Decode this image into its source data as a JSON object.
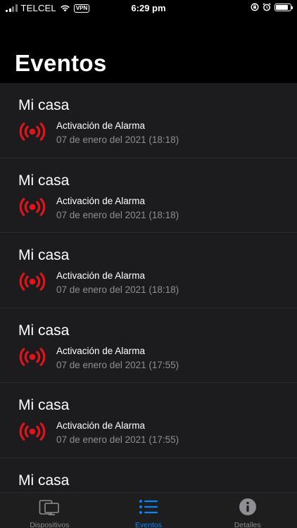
{
  "status_bar": {
    "carrier": "TELCEL",
    "vpn": "VPN",
    "time": "6:29 pm",
    "battery_level": 0.85
  },
  "page": {
    "title": "Eventos"
  },
  "events": [
    {
      "title": "Mi casa",
      "label": "Activación de Alarma",
      "date": "07 de enero del 2021 (18:18)"
    },
    {
      "title": "Mi casa",
      "label": "Activación de Alarma",
      "date": "07 de enero del 2021 (18:18)"
    },
    {
      "title": "Mi casa",
      "label": "Activación de Alarma",
      "date": "07 de enero del 2021 (18:18)"
    },
    {
      "title": "Mi casa",
      "label": "Activación de Alarma",
      "date": "07 de enero del 2021 (17:55)"
    },
    {
      "title": "Mi casa",
      "label": "Activación de Alarma",
      "date": "07 de enero del 2021 (17:55)"
    },
    {
      "title": "Mi casa",
      "label": "",
      "date": ""
    }
  ],
  "tab_bar": {
    "tabs": [
      {
        "label": "Dispositivos",
        "icon": "devices-icon",
        "active": false
      },
      {
        "label": "Eventos",
        "icon": "list-icon",
        "active": true
      },
      {
        "label": "Detalles",
        "icon": "info-icon",
        "active": false
      }
    ]
  },
  "colors": {
    "accent": "#0a84ff",
    "alarm_red": "#e0141a",
    "background": "#000000",
    "list_background": "#1c1c1e",
    "secondary_text": "#8e8e93"
  }
}
